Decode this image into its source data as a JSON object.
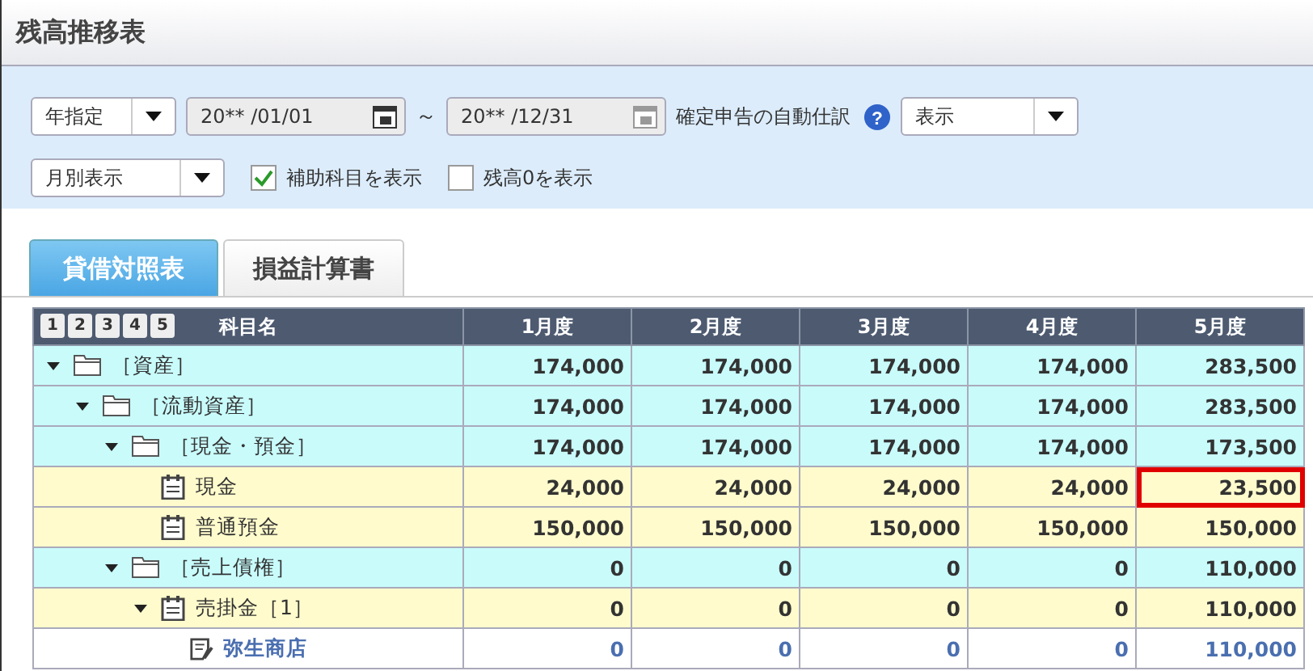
{
  "window": {
    "title": "残高推移表"
  },
  "filters": {
    "period_select": {
      "value": "年指定"
    },
    "date_from": {
      "value": "20** /01/01"
    },
    "range_sep": "～",
    "date_to": {
      "value": "20** /12/31"
    },
    "auto_entry_label": "確定申告の自動仕訳",
    "help_icon": "?",
    "auto_entry_select": {
      "value": "表示"
    },
    "view_select": {
      "value": "月別表示"
    },
    "checkboxes": [
      {
        "label": "補助科目を表示",
        "checked": true
      },
      {
        "label": "残高0を表示",
        "checked": false
      }
    ]
  },
  "tabs": [
    {
      "label": "貸借対照表",
      "selected": true
    },
    {
      "label": "損益計算書",
      "selected": false
    }
  ],
  "table": {
    "level_buttons": [
      "1",
      "2",
      "3",
      "4",
      "5"
    ],
    "columns": [
      "科目名",
      "1月度",
      "2月度",
      "3月度",
      "4月度",
      "5月度"
    ],
    "rows": [
      {
        "kind": "group",
        "name": "［資産］",
        "expanded": true,
        "values": [
          {
            "text": "174,000",
            "marked": false
          },
          {
            "text": "174,000",
            "marked": false
          },
          {
            "text": "174,000",
            "marked": false
          },
          {
            "text": "174,000",
            "marked": false
          },
          {
            "text": "283,500",
            "marked": false
          }
        ],
        "children": [
          {
            "kind": "group",
            "name": "［流動資産］",
            "expanded": true,
            "values": [
              {
                "text": "174,000",
                "marked": false
              },
              {
                "text": "174,000",
                "marked": false
              },
              {
                "text": "174,000",
                "marked": false
              },
              {
                "text": "174,000",
                "marked": false
              },
              {
                "text": "283,500",
                "marked": false
              }
            ],
            "children": [
              {
                "kind": "group",
                "name": "［現金・預金］",
                "expanded": true,
                "values": [
                  {
                    "text": "174,000",
                    "marked": false
                  },
                  {
                    "text": "174,000",
                    "marked": false
                  },
                  {
                    "text": "174,000",
                    "marked": false
                  },
                  {
                    "text": "174,000",
                    "marked": false
                  },
                  {
                    "text": "173,500",
                    "marked": false
                  }
                ],
                "children": [
                  {
                    "kind": "account",
                    "name": "現金",
                    "values": [
                      {
                        "text": "24,000",
                        "marked": false
                      },
                      {
                        "text": "24,000",
                        "marked": false
                      },
                      {
                        "text": "24,000",
                        "marked": false
                      },
                      {
                        "text": "24,000",
                        "marked": false
                      },
                      {
                        "text": "23,500",
                        "marked": true
                      }
                    ]
                  },
                  {
                    "kind": "account",
                    "name": "普通預金",
                    "values": [
                      {
                        "text": "150,000",
                        "marked": false
                      },
                      {
                        "text": "150,000",
                        "marked": false
                      },
                      {
                        "text": "150,000",
                        "marked": false
                      },
                      {
                        "text": "150,000",
                        "marked": false
                      },
                      {
                        "text": "150,000",
                        "marked": false
                      }
                    ]
                  }
                ]
              },
              {
                "kind": "group",
                "name": "［売上債権］",
                "expanded": true,
                "values": [
                  {
                    "text": "0",
                    "marked": false
                  },
                  {
                    "text": "0",
                    "marked": false
                  },
                  {
                    "text": "0",
                    "marked": false
                  },
                  {
                    "text": "0",
                    "marked": false
                  },
                  {
                    "text": "110,000",
                    "marked": false
                  }
                ],
                "children": [
                  {
                    "kind": "account",
                    "name": "売掛金［1］",
                    "expanded": true,
                    "values": [
                      {
                        "text": "0",
                        "marked": false
                      },
                      {
                        "text": "0",
                        "marked": false
                      },
                      {
                        "text": "0",
                        "marked": false
                      },
                      {
                        "text": "0",
                        "marked": false
                      },
                      {
                        "text": "110,000",
                        "marked": false
                      }
                    ],
                    "children": [
                      {
                        "kind": "sub_account",
                        "name": "弥生商店",
                        "values": [
                          {
                            "text": "0",
                            "marked": false
                          },
                          {
                            "text": "0",
                            "marked": false
                          },
                          {
                            "text": "0",
                            "marked": false
                          },
                          {
                            "text": "0",
                            "marked": false
                          },
                          {
                            "text": "110,000",
                            "marked": false
                          }
                        ]
                      }
                    ]
                  }
                ]
              }
            ]
          }
        ]
      }
    ]
  }
}
